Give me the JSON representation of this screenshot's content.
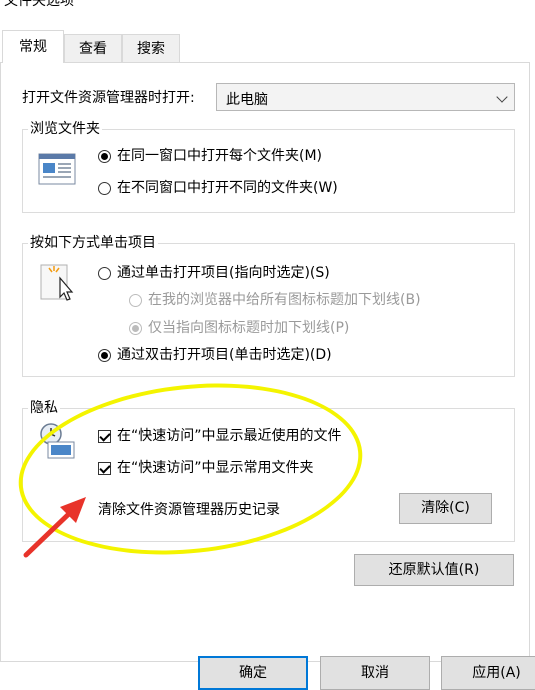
{
  "window": {
    "title": "文件夹选项"
  },
  "tabs": [
    {
      "label": "常规",
      "active": true
    },
    {
      "label": "查看",
      "active": false
    },
    {
      "label": "搜索",
      "active": false
    }
  ],
  "open_explorer": {
    "label": "打开文件资源管理器时打开:",
    "selected": "此电脑"
  },
  "browse_folders": {
    "title": "浏览文件夹",
    "options": [
      {
        "label": "在同一窗口中打开每个文件夹(M)",
        "checked": true
      },
      {
        "label": "在不同窗口中打开不同的文件夹(W)",
        "checked": false
      }
    ]
  },
  "click_items": {
    "title": "按如下方式单击项目",
    "single_click": "通过单击打开项目(指向时选定)(S)",
    "underline_all": "在我的浏览器中给所有图标标题加下划线(B)",
    "underline_point": "仅当指向图标标题时加下划线(P)",
    "double_click": "通过双击打开项目(单击时选定)(D)"
  },
  "privacy": {
    "title": "隐私",
    "show_recent": "在“快速访问”中显示最近使用的文件",
    "show_frequent": "在“快速访问”中显示常用文件夹",
    "clear_history_label": "清除文件资源管理器历史记录",
    "clear_button": "清除(C)"
  },
  "restore_defaults": "还原默认值(R)",
  "footer": {
    "ok": "确定",
    "cancel": "取消",
    "apply": "应用(A)"
  },
  "colors": {
    "annotation_highlight": "#f4f400",
    "annotation_arrow": "#e8332a",
    "focus_border": "#0078d7"
  }
}
